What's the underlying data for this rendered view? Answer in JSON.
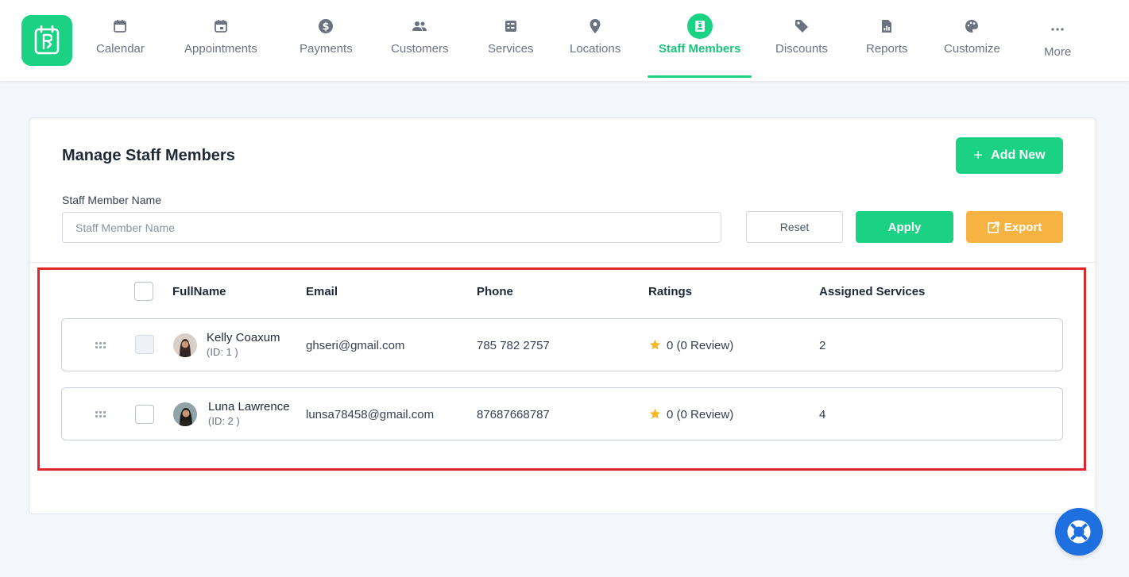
{
  "nav": {
    "items": [
      {
        "label": "Calendar",
        "icon": "calendar-icon"
      },
      {
        "label": "Appointments",
        "icon": "calendar-check-icon"
      },
      {
        "label": "Payments",
        "icon": "dollar-icon"
      },
      {
        "label": "Customers",
        "icon": "users-icon"
      },
      {
        "label": "Services",
        "icon": "list-icon"
      },
      {
        "label": "Locations",
        "icon": "location-pin-icon"
      },
      {
        "label": "Staff Members",
        "icon": "badge-icon",
        "active": true
      },
      {
        "label": "Discounts",
        "icon": "tag-icon"
      },
      {
        "label": "Reports",
        "icon": "report-icon"
      },
      {
        "label": "Customize",
        "icon": "palette-icon"
      },
      {
        "label": "More",
        "icon": "more-icon"
      }
    ],
    "accent_color": "#1bd184"
  },
  "page": {
    "title": "Manage Staff Members",
    "add_new_label": "Add New",
    "filter": {
      "label": "Staff Member Name",
      "placeholder": "Staff Member Name"
    },
    "reset_label": "Reset",
    "apply_label": "Apply",
    "export_label": "Export"
  },
  "table": {
    "columns": [
      "FullName",
      "Email",
      "Phone",
      "Ratings",
      "Assigned Services"
    ],
    "rows": [
      {
        "name": "Kelly Coaxum",
        "id": "(ID: 1 )",
        "email": "ghseri@gmail.com",
        "phone": "785 782 2757",
        "rating": "0 (0 Review)",
        "assigned": "2"
      },
      {
        "name": "Luna Lawrence",
        "id": "(ID: 2 )",
        "email": "lunsa78458@gmail.com",
        "phone": "87687668787",
        "rating": "0 (0 Review)",
        "assigned": "4"
      }
    ]
  },
  "colors": {
    "primary": "#1bd184",
    "export": "#f6b342",
    "highlight": "#e0262c",
    "help": "#1e6fe0"
  }
}
